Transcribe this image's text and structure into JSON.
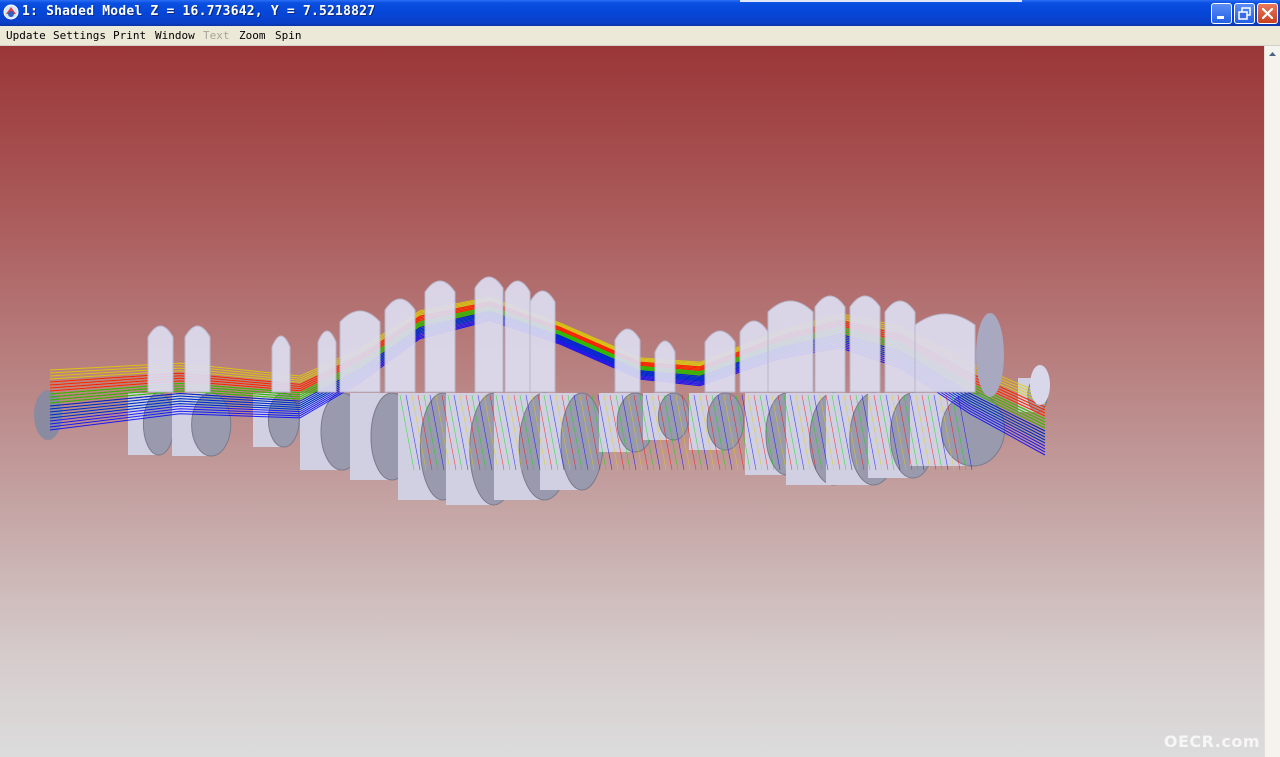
{
  "window": {
    "title": "1: Shaded Model Z = 16.773642, Y = 7.5218827",
    "icon": "app-icon",
    "controls": [
      "minimize-icon",
      "restore-icon",
      "close-icon"
    ]
  },
  "menu": {
    "items": [
      {
        "label": "Update",
        "enabled": true
      },
      {
        "label": "Settings",
        "enabled": true
      },
      {
        "label": "Print",
        "enabled": true
      },
      {
        "label": "Window",
        "enabled": true
      },
      {
        "label": "Text",
        "enabled": false
      },
      {
        "label": "Zoom",
        "enabled": true
      },
      {
        "label": "Spin",
        "enabled": true
      }
    ]
  },
  "viewport": {
    "watermark": "OECR.com",
    "colors": {
      "ray_red": "#ff0000",
      "ray_green": "#00e000",
      "ray_blue": "#0000ff",
      "ray_yellow": "#e0d000",
      "lens": "#dcdcf0"
    }
  }
}
